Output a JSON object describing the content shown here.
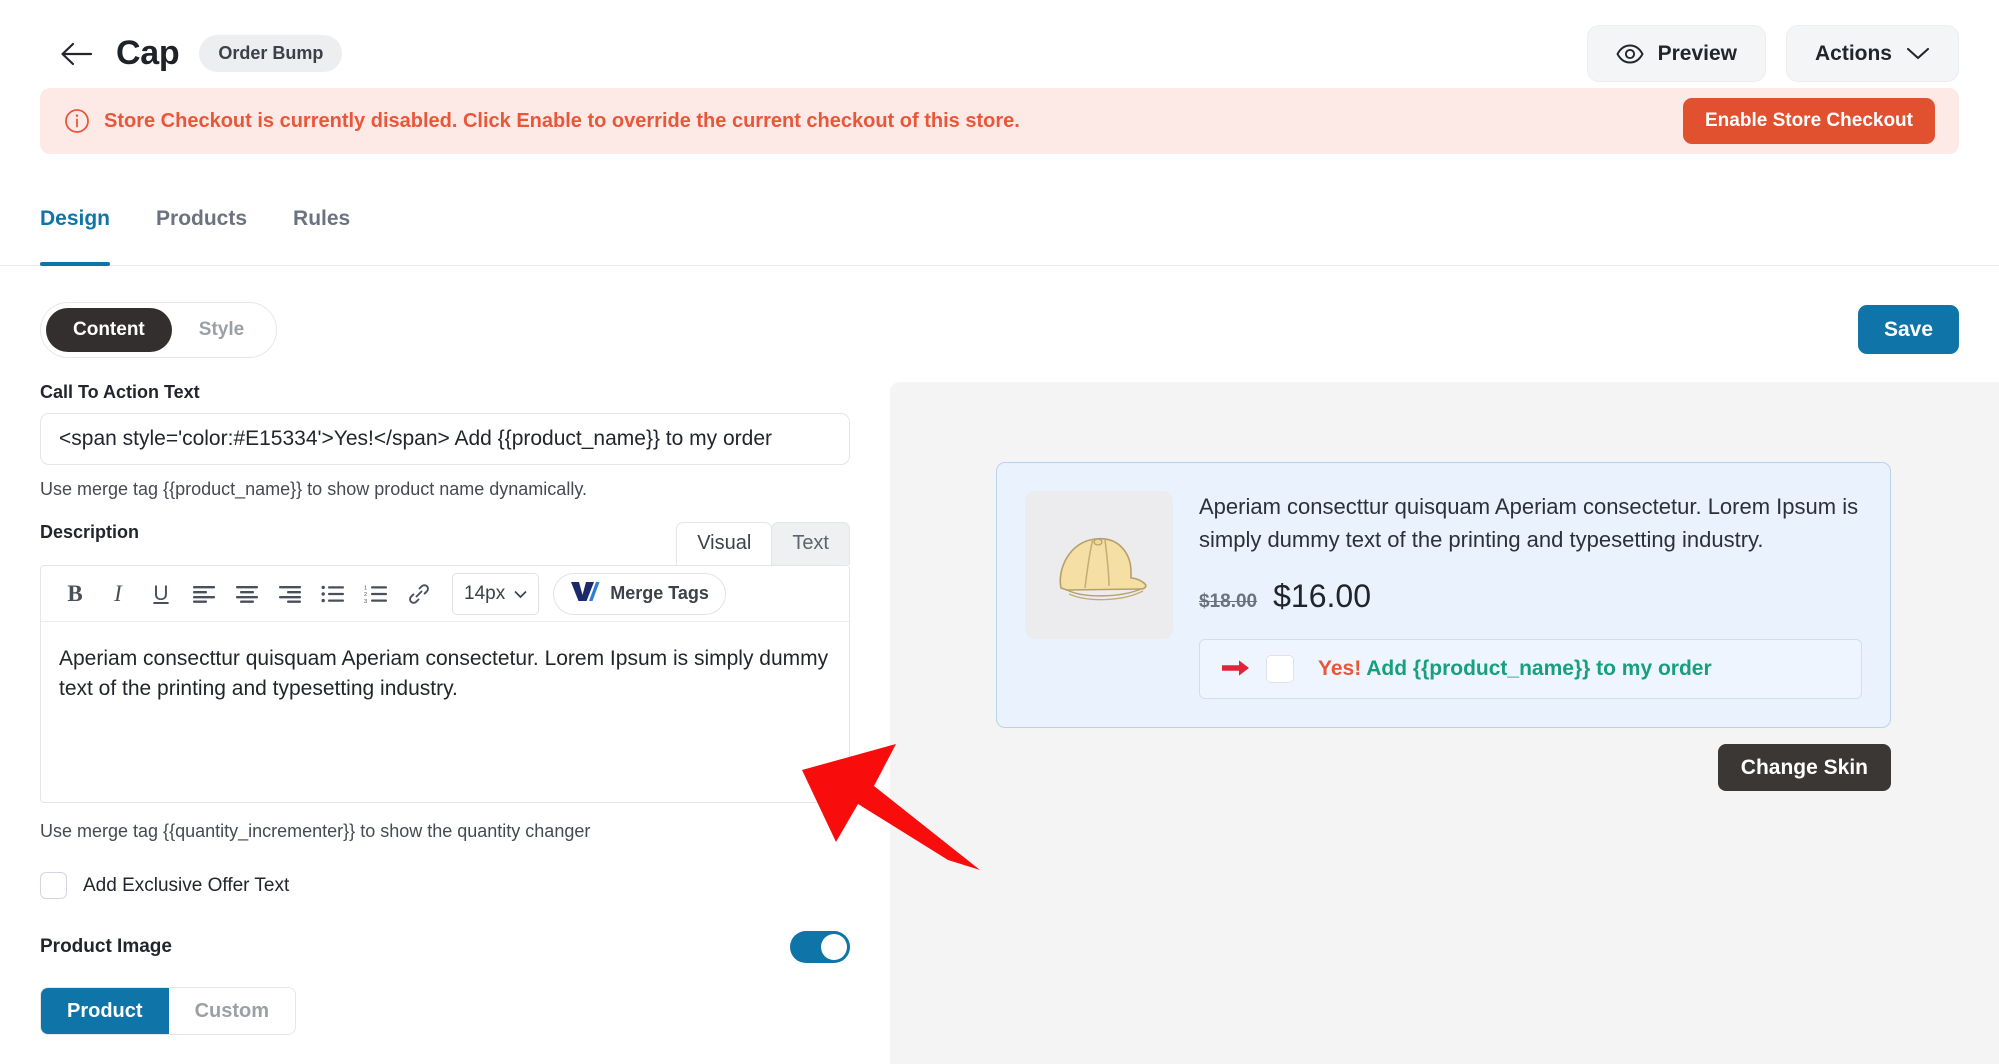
{
  "header": {
    "back_icon": "arrow-left-icon",
    "title": "Cap",
    "badge": "Order Bump",
    "preview_label": "Preview",
    "preview_icon": "eye-icon",
    "actions_label": "Actions",
    "actions_icon": "chevron-down-icon"
  },
  "alert": {
    "icon": "info-circle-icon",
    "message": "Store Checkout is currently disabled. Click Enable to override the current checkout of this store.",
    "button_label": "Enable Store Checkout",
    "bg_color": "#FDEAE6",
    "text_color": "#E8573A",
    "button_color": "#E1502F"
  },
  "tabs": [
    {
      "label": "Design",
      "active": true
    },
    {
      "label": "Products",
      "active": false
    },
    {
      "label": "Rules",
      "active": false
    }
  ],
  "segmented": {
    "content_label": "Content",
    "style_label": "Style",
    "active": "Content"
  },
  "save_label": "Save",
  "accent_color": "#0F74A8",
  "form": {
    "cta_label": "Call To Action Text",
    "cta_value": "<span style='color:#E15334'>Yes!</span> Add {{product_name}} to my order",
    "cta_placeholder": "Call To Action Text",
    "cta_helper": "Use merge tag {{product_name}} to show product name dynamically.",
    "description_label": "Description",
    "editor_tabs": [
      {
        "label": "Visual",
        "active": true
      },
      {
        "label": "Text",
        "active": false
      }
    ],
    "toolbar": {
      "bold": "B",
      "italic": "I",
      "underline": "U",
      "align_left": "align-left-icon",
      "align_center": "align-center-icon",
      "align_right": "align-right-icon",
      "bullet_list": "bullet-list-icon",
      "numbered_list": "numbered-list-icon",
      "link": "link-icon",
      "font_size": "14px",
      "merge_tags_label": "Merge Tags",
      "merge_tags_icon": "merge-tags-logo-icon"
    },
    "description_value": "Aperiam consecttur quisquam Aperiam consectetur. Lorem Ipsum is simply dummy text of the printing and typesetting industry.",
    "description_helper": "Use merge tag {{quantity_incrementer}} to show the quantity changer",
    "exclusive_offer_label": "Add Exclusive Offer Text",
    "exclusive_offer_checked": false,
    "product_image_label": "Product Image",
    "product_image_enabled": true,
    "image_source": {
      "product_label": "Product",
      "custom_label": "Custom",
      "active": "Product"
    }
  },
  "preview": {
    "product_image_icon": "cap-product-image",
    "description": "Aperiam consecttur quisquam Aperiam consectetur. Lorem Ipsum is simply dummy text of the printing and typesetting industry.",
    "price_old": "$18.00",
    "price_new": "$16.00",
    "cta_arrow_icon": "arrow-right-icon",
    "cta_checkbox_checked": false,
    "cta_yes": "Yes!",
    "cta_rest": "Add {{product_name}} to my order",
    "cta_yes_color": "#E8573A",
    "cta_rest_color": "#17A07E",
    "change_skin_label": "Change Skin",
    "card_bg": "#EAF2FD",
    "card_border": "#B9D2EE",
    "panel_bg": "#F4F4F5"
  },
  "annotation": {
    "arrow": "red-pointer-arrow"
  }
}
